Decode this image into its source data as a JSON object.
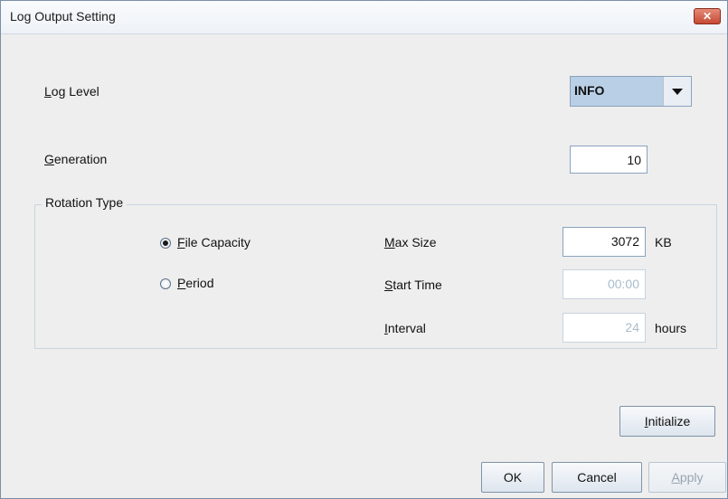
{
  "window": {
    "title": "Log Output Setting",
    "close_glyph": "✕"
  },
  "log_level": {
    "label": "Log Level",
    "value": "INFO"
  },
  "generation": {
    "label": "Generation",
    "value": "10"
  },
  "rotation": {
    "group_title": "Rotation Type",
    "option_file_capacity": "File Capacity",
    "option_period": "Period",
    "selected": "File Capacity",
    "max_size_label": "Max Size",
    "max_size_value": "3072",
    "max_size_unit": "KB",
    "start_time_label": "Start Time",
    "start_time_value": "00:00",
    "interval_label": "Interval",
    "interval_value": "24",
    "interval_unit": "hours"
  },
  "buttons": {
    "initialize": "Initialize",
    "ok": "OK",
    "cancel": "Cancel",
    "apply": "Apply"
  },
  "colors": {
    "selected_combo_bg": "#b8cfe5",
    "close_button": "#c64a33",
    "disabled_text": "#a9bccb"
  }
}
